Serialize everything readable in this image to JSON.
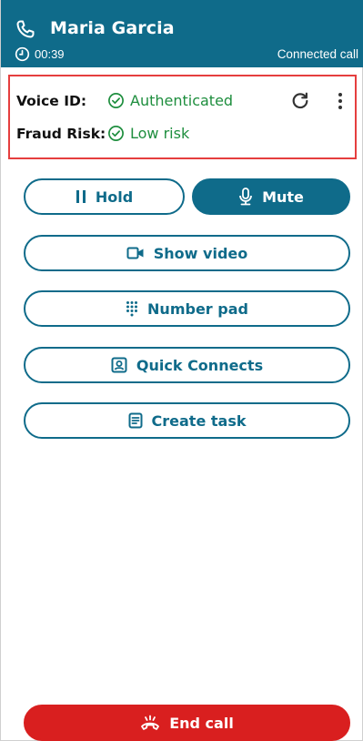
{
  "header": {
    "contact_name": "Maria Garcia",
    "timer": "00:39",
    "status": "Connected call",
    "bg_color": "#0f6b8a"
  },
  "voice_id": {
    "voice_label": "Voice ID:",
    "voice_status": "Authenticated",
    "fraud_label": "Fraud Risk:",
    "fraud_status": "Low risk",
    "status_color": "#1e8e3e",
    "highlight_color": "#e53e3e",
    "icons": [
      "check-circle-icon",
      "refresh-icon",
      "kebab-menu-icon"
    ]
  },
  "controls": {
    "hold": "Hold",
    "mute": "Mute",
    "show_video": "Show video",
    "number_pad": "Number pad",
    "quick_connects": "Quick Connects",
    "create_task": "Create task",
    "end_call": "End call"
  }
}
